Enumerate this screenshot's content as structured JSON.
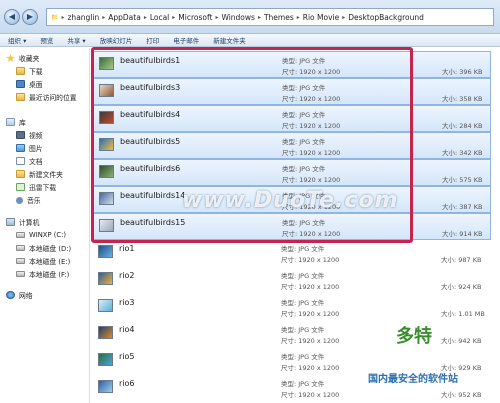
{
  "address": {
    "path": [
      "zhanglin",
      "AppData",
      "Local",
      "Microsoft",
      "Windows",
      "Themes",
      "Rio Movie",
      "DesktopBackground"
    ]
  },
  "toolbar": [
    "组织 ▾",
    "预览",
    "共享 ▾",
    "放映幻灯片",
    "打印",
    "电子邮件",
    "新建文件夹"
  ],
  "nav": {
    "favorites": {
      "title": "收藏夹",
      "items": [
        "下载",
        "桌面",
        "最近访问的位置"
      ]
    },
    "libraries": {
      "title": "库",
      "items": [
        "视频",
        "图片",
        "文档",
        "新建文件夹",
        "迅雷下载",
        "音乐"
      ]
    },
    "computer": {
      "title": "计算机",
      "items": [
        "WINXP (C:)",
        "本地磁盘 (D:)",
        "本地磁盘 (E:)",
        "本地磁盘 (F:)"
      ]
    },
    "network": {
      "title": "网络"
    }
  },
  "files": [
    {
      "name": "beautifulbirds1",
      "type": "类型: JPG 文件",
      "dims": "尺寸: 1920 x 1200",
      "size": "大小: 396 KB",
      "selected": true
    },
    {
      "name": "beautifulbirds3",
      "type": "类型: JPG 文件",
      "dims": "尺寸: 1920 x 1200",
      "size": "大小: 358 KB",
      "selected": true
    },
    {
      "name": "beautifulbirds4",
      "type": "类型: JPG 文件",
      "dims": "尺寸: 1920 x 1200",
      "size": "大小: 284 KB",
      "selected": true
    },
    {
      "name": "beautifulbirds5",
      "type": "类型: JPG 文件",
      "dims": "尺寸: 1920 x 1200",
      "size": "大小: 342 KB",
      "selected": true
    },
    {
      "name": "beautifulbirds6",
      "type": "类型: JPG 文件",
      "dims": "尺寸: 1920 x 1200",
      "size": "大小: 575 KB",
      "selected": true
    },
    {
      "name": "beautifulbirds14",
      "type": "类型: JPG 文件",
      "dims": "尺寸: 1920 x 1200",
      "size": "大小: 387 KB",
      "selected": true
    },
    {
      "name": "beautifulbirds15",
      "type": "类型: JPG 文件",
      "dims": "尺寸: 1920 x 1200",
      "size": "大小: 914 KB",
      "selected": true
    },
    {
      "name": "rio1",
      "type": "类型: JPG 文件",
      "dims": "尺寸: 1920 x 1200",
      "size": "大小: 987 KB",
      "selected": false
    },
    {
      "name": "rio2",
      "type": "类型: JPG 文件",
      "dims": "尺寸: 1920 x 1200",
      "size": "大小: 924 KB",
      "selected": false
    },
    {
      "name": "rio3",
      "type": "类型: JPG 文件",
      "dims": "尺寸: 1920 x 1200",
      "size": "大小: 1.01 MB",
      "selected": false
    },
    {
      "name": "rio4",
      "type": "类型: JPG 文件",
      "dims": "尺寸: 1920 x 1200",
      "size": "大小: 942 KB",
      "selected": false
    },
    {
      "name": "rio5",
      "type": "类型: JPG 文件",
      "dims": "尺寸: 1920 x 1200",
      "size": "大小: 929 KB",
      "selected": false
    },
    {
      "name": "rio6",
      "type": "类型: JPG 文件",
      "dims": "尺寸: 1920 x 1200",
      "size": "大小: 952 KB",
      "selected": false
    }
  ],
  "watermarks": {
    "center": "www.DuoTe.com",
    "logo": "多特",
    "footer": "国内最安全的软件站"
  },
  "colors": {
    "selection_border": "#c4244d",
    "selection_fill": "#d4e6fa",
    "toolbar_bg": "#dce7f4"
  }
}
